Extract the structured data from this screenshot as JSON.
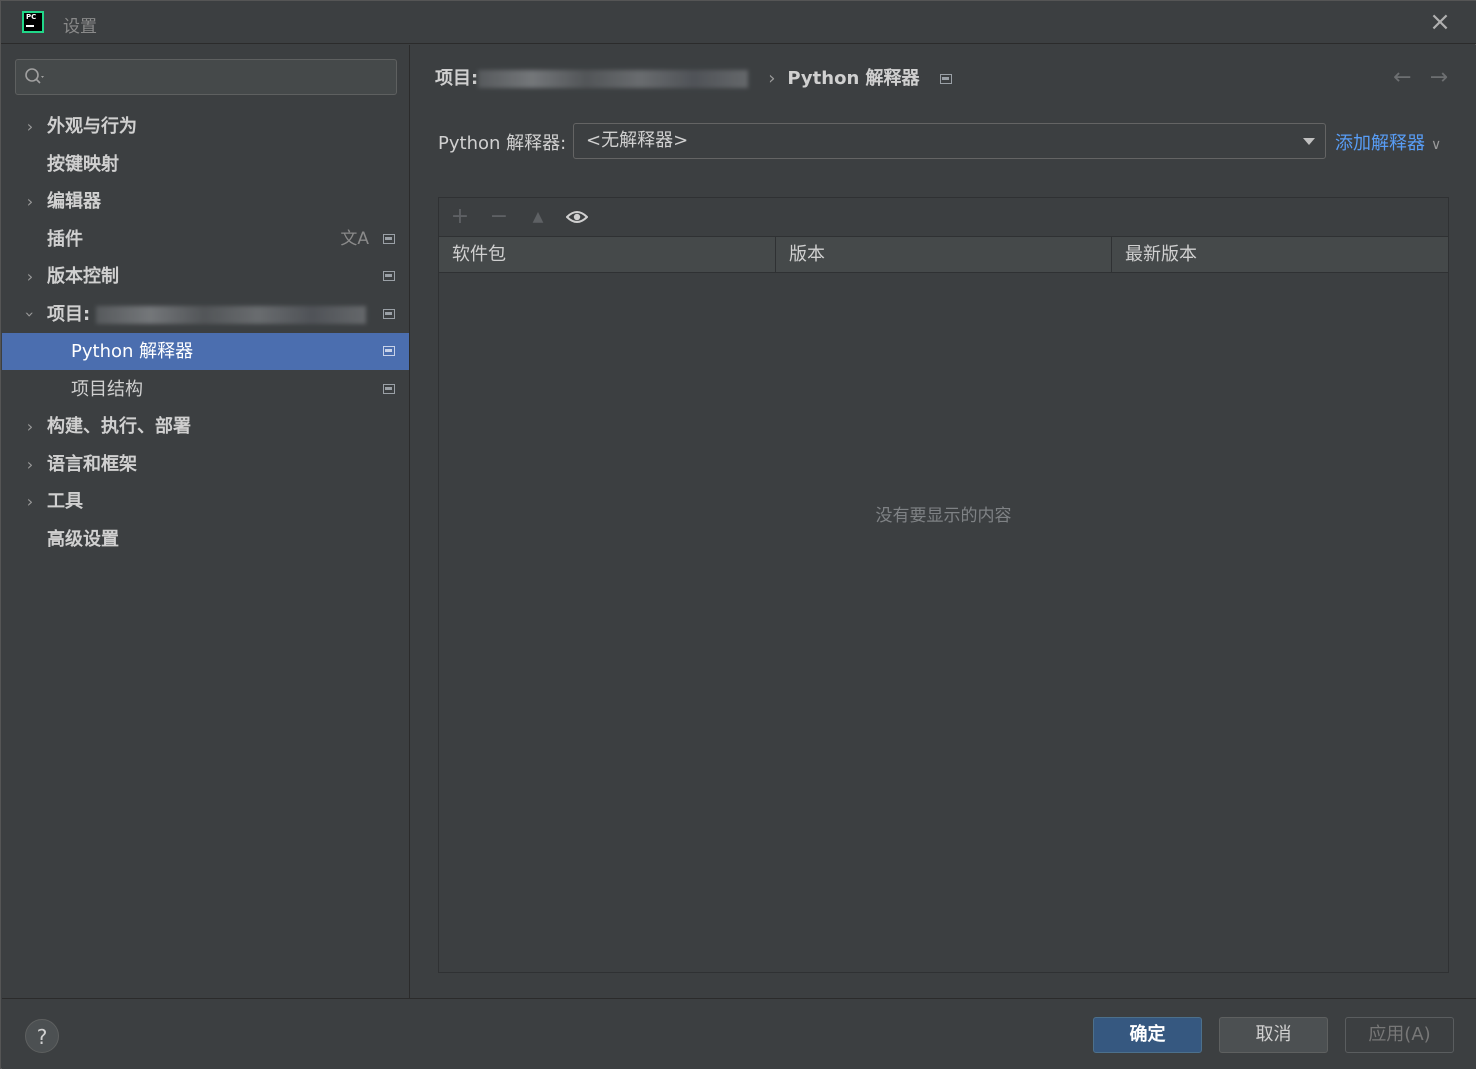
{
  "window": {
    "title": "设置"
  },
  "search": {
    "placeholder": ""
  },
  "sidebar": {
    "items": [
      {
        "label": "外观与行为"
      },
      {
        "label": "按键映射"
      },
      {
        "label": "编辑器"
      },
      {
        "label": "插件"
      },
      {
        "label": "版本控制"
      },
      {
        "label": "项目: "
      },
      {
        "label": "Python 解释器"
      },
      {
        "label": "项目结构"
      },
      {
        "label": "构建、执行、部署"
      },
      {
        "label": "语言和框架"
      },
      {
        "label": "工具"
      },
      {
        "label": "高级设置"
      }
    ]
  },
  "breadcrumb": {
    "project": "项目:",
    "page": "Python 解释器"
  },
  "interpreter": {
    "label": "Python 解释器:",
    "selected": "<无解释器>",
    "add_label": "添加解释器"
  },
  "packages": {
    "columns": [
      "软件包",
      "版本",
      "最新版本"
    ],
    "empty_text": "没有要显示的内容"
  },
  "footer": {
    "help": "?",
    "ok": "确定",
    "cancel": "取消",
    "apply": "应用(A)"
  }
}
